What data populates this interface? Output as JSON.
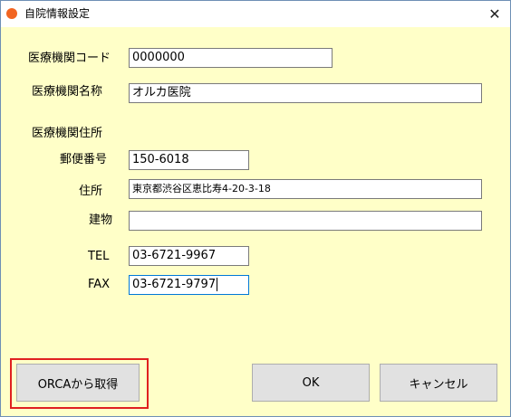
{
  "window": {
    "title": "自院情報設定"
  },
  "form": {
    "code_label": "医療機関コード",
    "code_value": "0000000",
    "name_label": "医療機関名称",
    "name_value": "オルカ医院",
    "address_section_label": "医療機関住所",
    "postal_label": "郵便番号",
    "postal_value": "150-6018",
    "address_label": "住所",
    "address_value": "東京都渋谷区恵比寿4-20-3-18",
    "building_label": "建物",
    "building_value": "",
    "tel_label": "TEL",
    "tel_value": "03-6721-9967",
    "fax_label": "FAX",
    "fax_value": "03-6721-9797"
  },
  "buttons": {
    "orca_fetch": "ORCAから取得",
    "ok": "OK",
    "cancel": "キャンセル"
  },
  "colors": {
    "background": "#ffffc8",
    "highlight": "#e02020",
    "app_icon": "#f26522"
  }
}
